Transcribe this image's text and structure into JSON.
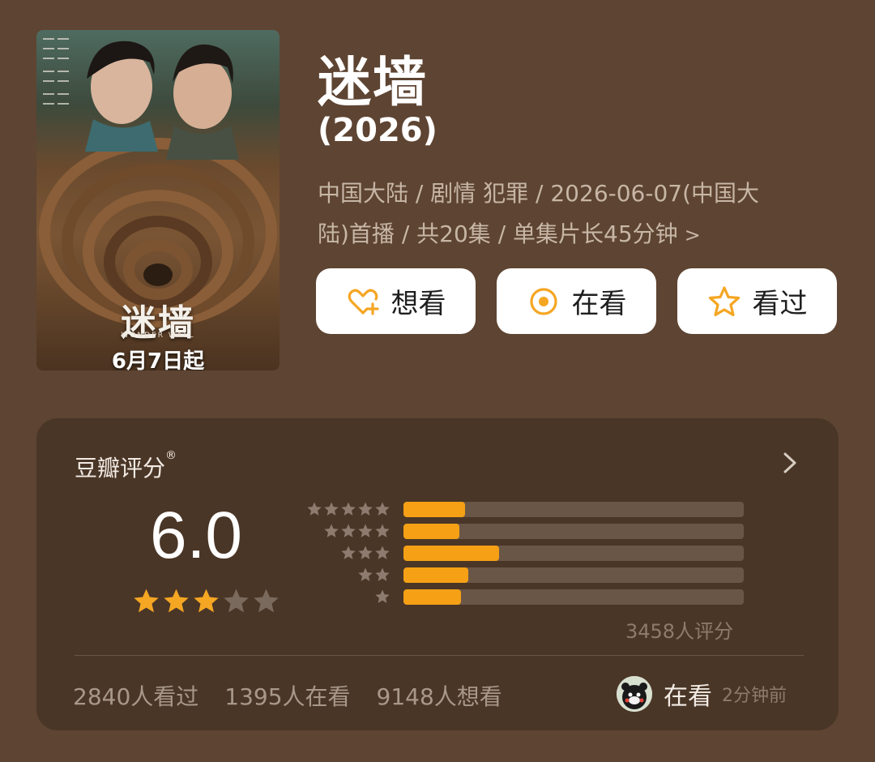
{
  "poster": {
    "logo_text": "迷墙",
    "subtitle": "WONDER WALL",
    "date_text": "6月7日起"
  },
  "header": {
    "title": "迷墙",
    "year": "(2026)",
    "meta_line1": "中国大陆 / 剧情 犯罪 / 2026-06-07(中国大",
    "meta_line2": "陆)首播 / 共20集 / 单集片长45分钟"
  },
  "actions": {
    "want_label": "想看",
    "watching_label": "在看",
    "watched_label": "看过"
  },
  "rating": {
    "title": "豆瓣评分",
    "title_mark": "®",
    "score": "6.0",
    "score_stars": 3,
    "distribution": [
      {
        "stars": 5,
        "fraction": 0.18
      },
      {
        "stars": 4,
        "fraction": 0.165
      },
      {
        "stars": 3,
        "fraction": 0.28
      },
      {
        "stars": 2,
        "fraction": 0.19
      },
      {
        "stars": 1,
        "fraction": 0.17
      }
    ],
    "count_text": "3458人评分",
    "watched_text": "2840人看过",
    "watching_text": "1395人在看",
    "want_text": "9148人想看",
    "recent_status": "在看",
    "recent_time": "2分钟前"
  },
  "colors": {
    "background": "#5e4432",
    "card": "#4a3627",
    "accent_orange": "#f5a015",
    "star_gold": "#f5a623",
    "star_empty": "#7a6a5e"
  }
}
